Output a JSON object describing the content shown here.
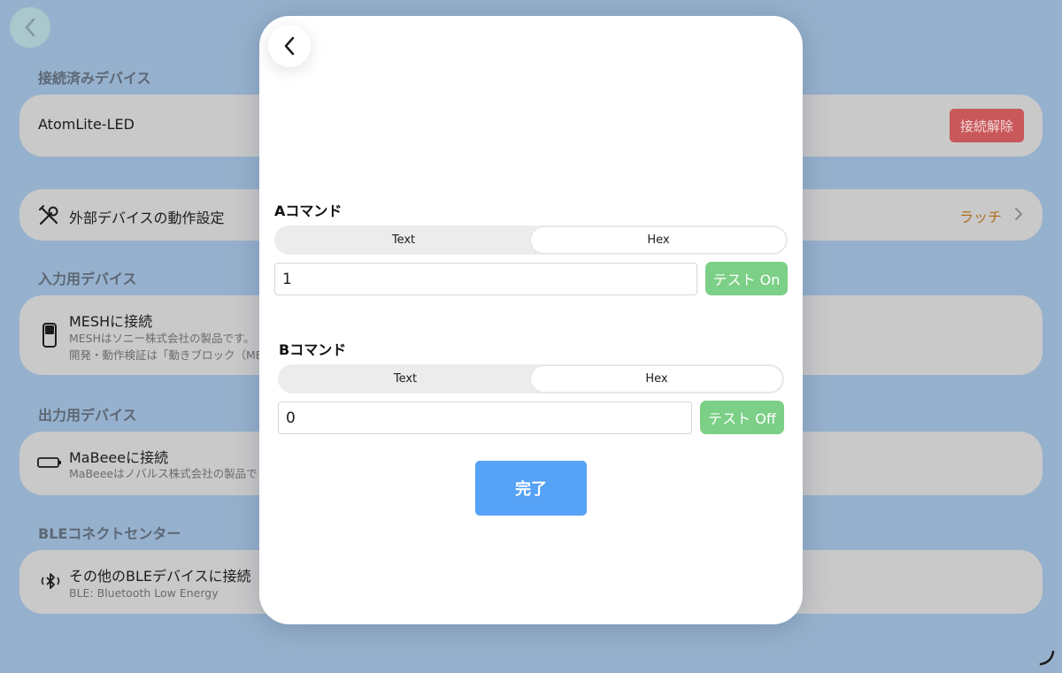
{
  "background": {
    "back_icon": "chevron-left-icon",
    "sections": {
      "connected": "接続済みデバイス",
      "input": "入力用デバイス",
      "output": "出力用デバイス",
      "ble_center": "BLEコネクトセンター"
    },
    "connected_device": {
      "name": "AtomLite-LED",
      "disconnect_label": "接続解除"
    },
    "external_settings": {
      "icon": "tools-icon",
      "label": "外部デバイスの動作設定",
      "value": "ラッチ"
    },
    "mesh": {
      "icon": "mesh-block-icon",
      "title": "MESHに接続",
      "desc_line1": "MESHはソニー株式会社の製品です。",
      "desc_line2": "開発・動作検証は「動きブロック（ME"
    },
    "mabeee": {
      "icon": "battery-icon",
      "title": "MaBeeeに接続",
      "desc": "MaBeeeはノバルス株式会社の製品で"
    },
    "ble": {
      "icon": "bluetooth-icon",
      "title": "その他のBLEデバイスに接続",
      "desc": "BLE: Bluetooth Low Energy"
    }
  },
  "modal": {
    "back_icon": "chevron-left-icon",
    "command_a": {
      "label": "Aコマンド",
      "format_options": [
        "Text",
        "Hex"
      ],
      "selected_format": "Hex",
      "value": "1",
      "test_label": "テスト On"
    },
    "command_b": {
      "label": "Bコマンド",
      "format_options": [
        "Text",
        "Hex"
      ],
      "selected_format": "Hex",
      "value": "0",
      "test_label": "テスト Off"
    },
    "done_label": "完了"
  },
  "colors": {
    "backdrop": "#96b1cd",
    "disconnect": "#c9585a",
    "latch_value": "#b06d1c",
    "test_button": "#7ccf86",
    "done_button": "#55a2f6"
  }
}
